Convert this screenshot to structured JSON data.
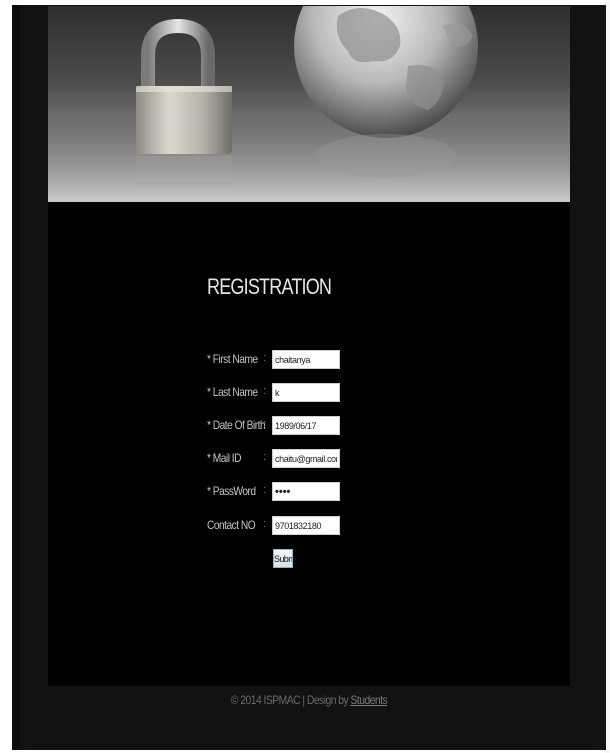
{
  "form": {
    "title": "REGISTRATION",
    "fields": [
      {
        "label": "* First Name",
        "value": "chaitanya",
        "type": "text"
      },
      {
        "label": "* Last Name",
        "value": "k",
        "type": "text"
      },
      {
        "label": "* Date Of Birth",
        "value": "1989/06/17",
        "type": "text"
      },
      {
        "label": "* Mail ID",
        "value": "chaitu@gmail.com",
        "type": "text"
      },
      {
        "label": "* PassWord",
        "value": "abcd",
        "type": "password"
      },
      {
        "label": "Contact NO",
        "value": "9701832180",
        "type": "text"
      }
    ],
    "separator": ":",
    "submit_label": "Submit"
  },
  "footer": {
    "text": "© 2014 ISPMAC | Design by",
    "link_label": "Students"
  },
  "colors": {
    "page_background": "#111311",
    "panel_background": "#000000",
    "text": "#c4c4c4"
  },
  "icons": {
    "banner": "padlock-and-globe-banner"
  }
}
